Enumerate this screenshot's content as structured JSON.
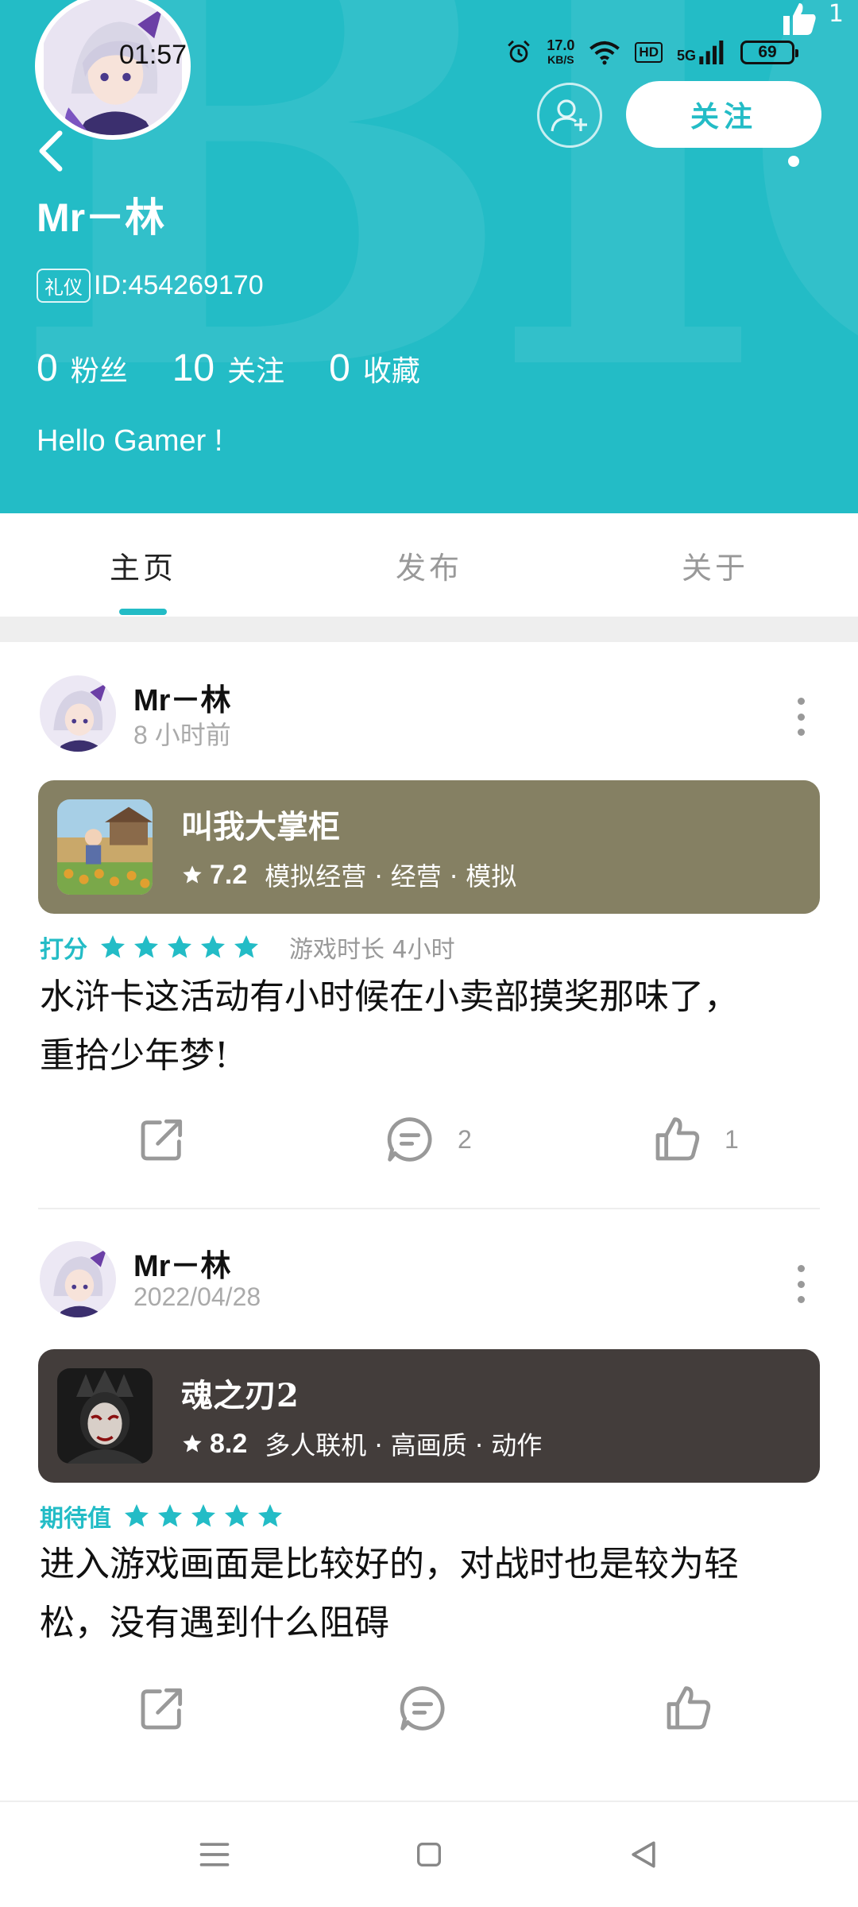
{
  "status_bar": {
    "time": "01:57",
    "net_speed_value": "17.0",
    "net_speed_unit": "KB/S",
    "hd_label": "HD",
    "signal_label": "5G",
    "battery": "69"
  },
  "header": {
    "bg_color": "#23bcc6",
    "watermark": "BIO",
    "like_count": "1",
    "follow_label": "关注",
    "username": "Mr－林",
    "badge": "礼仪",
    "id_text": "ID:454269170",
    "stats": [
      {
        "num": "0",
        "label": "粉丝"
      },
      {
        "num": "10",
        "label": "关注"
      },
      {
        "num": "0",
        "label": "收藏"
      }
    ],
    "bio": "Hello Gamer !"
  },
  "tabs": [
    {
      "label": "主页",
      "active": true
    },
    {
      "label": "发布",
      "active": false
    },
    {
      "label": "关于",
      "active": false
    }
  ],
  "posts": [
    {
      "author": "Mr－林",
      "time": "8 小时前",
      "game": {
        "title": "叫我大掌柜",
        "score": "7.2",
        "tags": "模拟经营 · 经营 · 模拟",
        "card_color": "#858063"
      },
      "rating_label": "打分",
      "stars": 5,
      "playtime": "游戏时长 4小时",
      "text_line1": "水浒卡这活动有小时候在小卖部摸奖那味了，",
      "text_line2": "重拾少年梦!",
      "comments": "2",
      "likes": "1"
    },
    {
      "author": "Mr－林",
      "time": "2022/04/28",
      "game": {
        "title": "魂之刃2",
        "score": "8.2",
        "tags": "多人联机 · 高画质 · 动作",
        "card_color": "#433d3b"
      },
      "rating_label": "期待值",
      "stars": 5,
      "text_line1": "进入游戏画面是比较好的，对战时也是较为轻",
      "text_line2": "松，没有遇到什么阻碍"
    }
  ],
  "icons": {
    "back": "chevron-left-icon",
    "add_friend": "add-user-icon",
    "share": "share-icon",
    "comment": "comment-icon",
    "like": "thumbs-up-icon",
    "star": "star-icon",
    "nav_menu": "menu-icon",
    "nav_home": "square-icon",
    "nav_back": "triangle-back-icon"
  }
}
